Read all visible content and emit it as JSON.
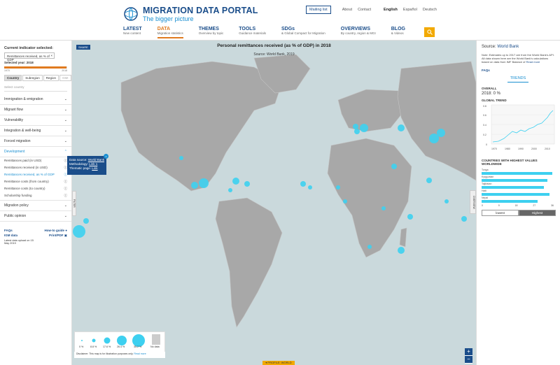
{
  "header": {
    "logo_title": "MIGRATION DATA PORTAL",
    "logo_subtitle": "The bigger picture",
    "mailing_list": "Mailing list",
    "about": "About",
    "contact": "Contact",
    "languages": [
      "English",
      "Español",
      "Deutsch"
    ],
    "nav": [
      {
        "title": "LATEST",
        "sub": "New content"
      },
      {
        "title": "DATA",
        "sub": "Migration statistics"
      },
      {
        "title": "THEMES",
        "sub": "Overview by topic"
      },
      {
        "title": "TOOLS",
        "sub": "Guidance materials"
      },
      {
        "title": "SDGs",
        "sub": "& Global Compact for Migration"
      },
      {
        "title": "OVERVIEWS",
        "sub": "By country, region & MGI"
      },
      {
        "title": "BLOG",
        "sub": "& Videos"
      }
    ],
    "accent": "#e07a1f",
    "brand": "#1a4d8a",
    "search_color": "#f2a900"
  },
  "sidebar": {
    "current_label": "Current indicator selected:",
    "indicator": "Remittances received, as % of GDP",
    "selected_year": "Selected year: 2018",
    "year_start": "1970",
    "year_end": "2018",
    "year_progress": 0.99,
    "geo_tabs": [
      "Country",
      "Subregion",
      "Region",
      "GMI"
    ],
    "select_country": "Select country",
    "categories_top": [
      "Immigration & emigration",
      "Migrant flow",
      "Vulnerability",
      "Integration & well-being",
      "Forced migration"
    ],
    "open_category": "Development",
    "sub_items": [
      "Remittances paid (in USD)",
      "Remittances received (in USD)",
      "Remittances received, as % of GDP",
      "Remittance costs (from country)",
      "Remittance costs (to country)",
      "Scholarship funding"
    ],
    "categories_bottom": [
      "Migration policy",
      "Public opinion"
    ],
    "faqs": "FAQs",
    "howto": "How-to guide",
    "igm": "IGM data",
    "print": "Print/PDF",
    "upload": "Latest data upload on 15 May 2019"
  },
  "map": {
    "title": "Personal remittances received (as % of GDP) in 2018",
    "source": "Source: World Bank, 2019",
    "share": "SHARE",
    "popup": {
      "source_label": "Data source:",
      "source_link": "World Bank",
      "method_label": "Methodology:",
      "method_link": "Link 1",
      "thematic_label": "Thematic page:",
      "thematic_link": "Link"
    },
    "filter": "FILTER",
    "overview": "OVERVIEW",
    "legend": [
      "0 %",
      "8.8 %",
      "17.6 %",
      "26.4 %",
      "35.2 %",
      "No data"
    ],
    "disclaimer": "Disclaimer: This map is for illustration purposes only.",
    "read_more": "Read more",
    "profile": "▾ PROFILE: WORLD",
    "water_color": "#cad9dc",
    "land_color": "#a8a8a8",
    "bubble_color": "#3dd0f0"
  },
  "right_panel": {
    "source_label": "Source:",
    "source_link": "World Bank",
    "note": "Note: Estimates up to 2017 are from the World Bank's API. All data shown here are the World Bank's calculations based on data from IMF Balance of",
    "read_more": "Read more",
    "faqs": "FAQs",
    "trends": "TRENDS",
    "overall": "OVERALL",
    "overall_value": "2018: 0 %",
    "global_trend": "GLOBAL TREND",
    "trend_yticks": [
      "0.8",
      "0.6",
      "0.4",
      "0.2",
      "0"
    ],
    "trend_xticks": [
      "1970",
      "1980",
      "1990",
      "2000",
      "2010"
    ],
    "countries_header": "COUNTRIES WITH HIGHEST VALUES WORLDWIDE",
    "countries": [
      {
        "name": "Tonga",
        "value": 35.2
      },
      {
        "name": "Kyrgyzstan",
        "value": 33.0
      },
      {
        "name": "Tajikistan",
        "value": 31.0
      },
      {
        "name": "Haiti",
        "value": 34.0
      },
      {
        "name": "Nepal",
        "value": 28.0
      }
    ],
    "bar_axis": [
      "0",
      "9",
      "18",
      "27",
      "36"
    ],
    "lowest": "lowest",
    "highest": "Highest"
  }
}
